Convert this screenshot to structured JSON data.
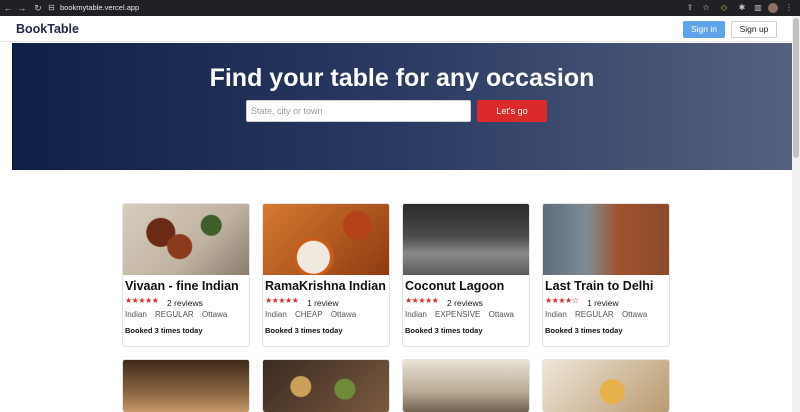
{
  "browser": {
    "url": "bookmytable.vercel.app"
  },
  "header": {
    "brand": "BookTable",
    "signin_label": "Sign in",
    "signup_label": "Sign up"
  },
  "hero": {
    "title": "Find your table for any occasion",
    "search_placeholder": "State, city or town",
    "go_label": "Let's go"
  },
  "restaurants": [
    {
      "name": "Vivaan - fine Indian",
      "stars": "★★★★★",
      "rating": 4.5,
      "reviews": "2 reviews",
      "cuisine": "Indian",
      "price": "REGULAR",
      "city": "Ottawa",
      "booked": "Booked 3 times today"
    },
    {
      "name": "RamaKrishna Indian",
      "stars": "★★★★★",
      "rating": 5,
      "reviews": "1 review",
      "cuisine": "Indian",
      "price": "CHEAP",
      "city": "Ottawa",
      "booked": "Booked 3 times today"
    },
    {
      "name": "Coconut Lagoon",
      "stars": "★★★★★",
      "rating": 5,
      "reviews": "2 reviews",
      "cuisine": "Indian",
      "price": "EXPENSIVE",
      "city": "Ottawa",
      "booked": "Booked 3 times today"
    },
    {
      "name": "Last Train to Delhi",
      "stars": "★★★★☆",
      "rating": 4,
      "reviews": "1 review",
      "cuisine": "Indian",
      "price": "REGULAR",
      "city": "Ottawa",
      "booked": "Booked 3 times today"
    }
  ],
  "colors": {
    "brand": "#222b45",
    "signin_bg": "#5fa3ec",
    "go_bg": "#dc2a2a",
    "star": "#d62d2d"
  }
}
